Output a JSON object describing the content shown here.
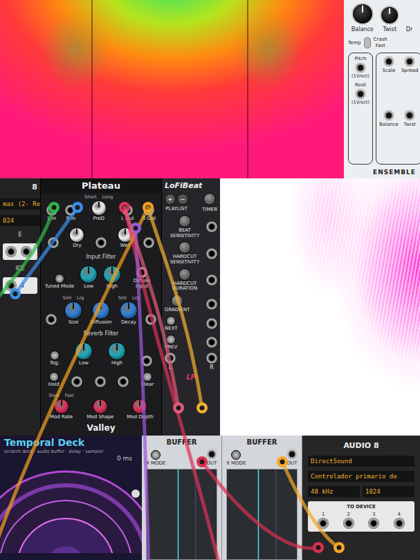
{
  "ensemble": {
    "cut_label": "Dr",
    "knobs": [
      "Balance",
      "Twist"
    ],
    "switch_labels": [
      "Temp",
      "Crash",
      "Fast"
    ],
    "inputs_left": [
      {
        "label": "Pitch",
        "sub": "(1V/oct)"
      },
      {
        "label": "Root",
        "sub": "(1V/oct)"
      }
    ],
    "inputs_right": [
      "Scale",
      "Spread",
      "Balance",
      "Twist"
    ],
    "title": "ENSEMBLE"
  },
  "left_module": {
    "title": "8",
    "device": "mas (2- Re",
    "buffer": "024",
    "sections": [
      "E",
      "ICE"
    ],
    "port": "4"
  },
  "plateau": {
    "title": "Plateau",
    "footer": "Valley",
    "rows": [
      {
        "controls": [
          {
            "kind": "jack",
            "label": "L In"
          },
          {
            "kind": "jack",
            "label": "R In"
          },
          {
            "kind": "knob",
            "label": "PreD",
            "color": "#f2f2f2",
            "range": [
              "Short",
              "Long"
            ]
          },
          {
            "kind": "jack",
            "label": "L Out"
          },
          {
            "kind": "jack",
            "label": "R Out"
          }
        ]
      },
      {
        "controls": [
          {
            "kind": "jack"
          },
          {
            "kind": "knob",
            "label": "Dry",
            "color": "#f2f2f2"
          },
          {
            "kind": "jack"
          },
          {
            "kind": "knob",
            "label": "Wet",
            "color": "#f2f2f2"
          },
          {
            "kind": "jack"
          }
        ],
        "section": "Input Filter"
      },
      {
        "controls": [
          {
            "kind": "button",
            "label": "Tuned Mode"
          },
          {
            "kind": "knob",
            "label": "Low",
            "color": "#1fa9b8"
          },
          {
            "kind": "knob",
            "label": "High",
            "color": "#1fa9b8"
          },
          {
            "kind": "jack",
            "label": "Diffuse Input"
          }
        ]
      },
      {
        "controls": [
          {
            "kind": "jack"
          },
          {
            "kind": "knob",
            "label": "Size",
            "color": "#2f7fd8",
            "range": [
              "Sml",
              "Lrg"
            ]
          },
          {
            "kind": "knob",
            "label": "Diffusion",
            "color": "#2f7fd8"
          },
          {
            "kind": "knob",
            "label": "Decay",
            "color": "#2f7fd8",
            "range": [
              "Sml",
              "Lrg"
            ]
          },
          {
            "kind": "jack"
          }
        ],
        "section": "Reverb Filter"
      },
      {
        "controls": [
          {
            "kind": "button",
            "label": "Tog."
          },
          {
            "kind": "knob",
            "label": "Low",
            "color": "#1fa9b8"
          },
          {
            "kind": "knob",
            "label": "High",
            "color": "#1fa9b8"
          },
          {
            "kind": "jack"
          }
        ]
      },
      {
        "controls": [
          {
            "kind": "button",
            "label": "Hold"
          },
          {
            "kind": "jack"
          },
          {
            "kind": "jack"
          },
          {
            "kind": "jack"
          },
          {
            "kind": "button",
            "label": "Clear"
          }
        ]
      },
      {
        "controls": [
          {
            "kind": "knob",
            "label": "Mod Rate",
            "color": "#e0305a",
            "range": [
              "Slow",
              "Fast"
            ]
          },
          {
            "kind": "knob",
            "label": "Mod Shape",
            "color": "#e0305a"
          },
          {
            "kind": "knob",
            "label": "Mod Depth",
            "color": "#e0305a"
          }
        ]
      }
    ]
  },
  "lofi": {
    "title": "LoFiBeat",
    "playlist": {
      "buttons": [
        "+",
        "−"
      ],
      "label": "PLAYLIST"
    },
    "timer": "TIMER",
    "rows": [
      {
        "kind": "knob",
        "label": "BEAT SENSITIVITY"
      },
      {
        "kind": "knob",
        "label": "HARDCUT SENSITIVITY"
      },
      {
        "kind": "knob",
        "label": "HARDCUT DURATION"
      },
      {
        "kind": "knob",
        "label": "GRADIENT"
      },
      {
        "kind": "button",
        "label": "NEXT"
      },
      {
        "kind": "button",
        "label": "PREV"
      }
    ],
    "outputs": [
      "L",
      "R"
    ],
    "logo": "LP"
  },
  "temporal_deck": {
    "title": "Temporal Deck",
    "subtitle": "scratch deck · audio buffer · delay · sampler",
    "readout": "0 ms"
  },
  "buffers": [
    {
      "title": "BUFFER",
      "mode": "X MODE",
      "output": "OUT"
    },
    {
      "title": "BUFFER",
      "mode": "X MODE",
      "output": "OUT"
    }
  ],
  "audio": {
    "title": "AUDIO 8",
    "driver": "DirectSound",
    "device": "Controlador primario de",
    "rate": "48 kHz",
    "buffer": "1024",
    "section": "TO DEVICE",
    "ports": [
      "1",
      "2",
      "3",
      "4"
    ]
  },
  "cables": [
    {
      "color": "#2fb84a"
    },
    {
      "color": "#3b8ee6"
    },
    {
      "color": "#e0315a"
    },
    {
      "color": "#f0a020"
    },
    {
      "color": "#9b59d6"
    },
    {
      "color": "#e05a7a"
    },
    {
      "color": "#f0b030"
    },
    {
      "color": "#d8304f"
    },
    {
      "color": "#f2a828"
    }
  ]
}
